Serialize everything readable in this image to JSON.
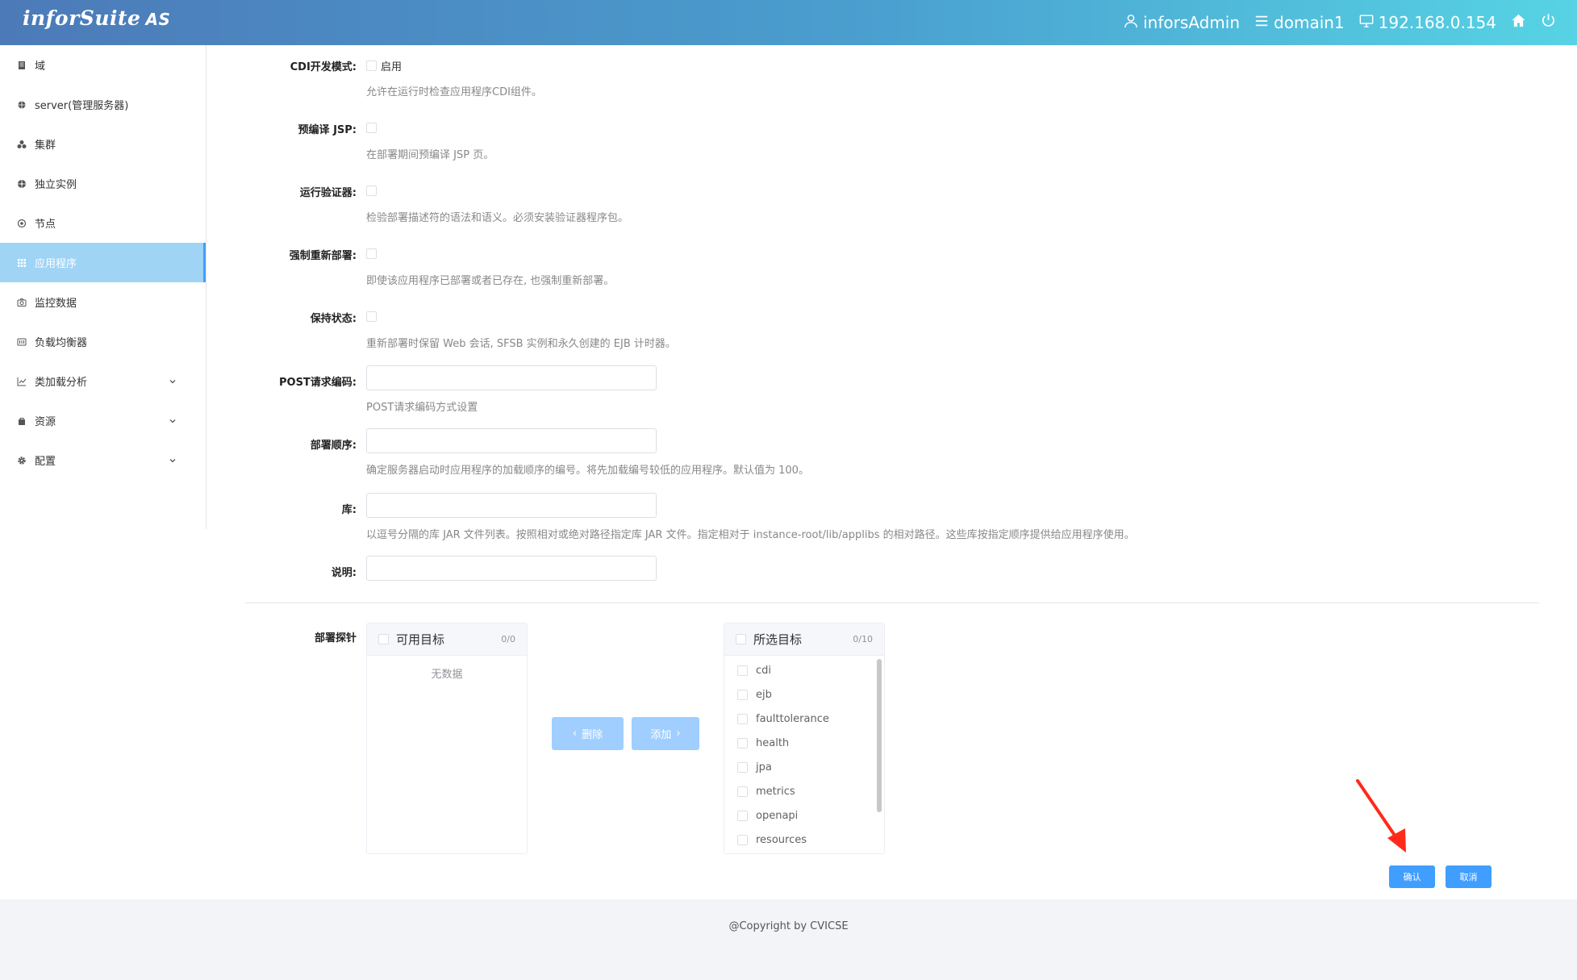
{
  "header": {
    "logo_main": "inforSuite",
    "logo_suffix": "AS",
    "user": "inforsAdmin",
    "domain": "domain1",
    "ip": "192.168.0.154",
    "icons": [
      "user-icon",
      "list-icon",
      "monitor-icon",
      "home-icon",
      "power-icon"
    ]
  },
  "sidebar": {
    "items": [
      {
        "label": "域",
        "icon": "domain-icon"
      },
      {
        "label": "server(管理服务器)",
        "icon": "server-icon"
      },
      {
        "label": "集群",
        "icon": "cluster-icon"
      },
      {
        "label": "独立实例",
        "icon": "instance-icon"
      },
      {
        "label": "节点",
        "icon": "node-icon"
      },
      {
        "label": "应用程序",
        "icon": "apps-icon",
        "active": true
      },
      {
        "label": "监控数据",
        "icon": "camera-icon"
      },
      {
        "label": "负载均衡器",
        "icon": "balancer-icon"
      },
      {
        "label": "类加载分析",
        "icon": "chart-icon",
        "expandable": true
      },
      {
        "label": "资源",
        "icon": "resource-icon",
        "expandable": true
      },
      {
        "label": "配置",
        "icon": "gear-icon",
        "expandable": true
      }
    ]
  },
  "form": {
    "cdi": {
      "label": "CDI开发模式:",
      "option": "启用",
      "help": "允许在运行时检查应用程序CDI组件。"
    },
    "precompile": {
      "label": "预编译 JSP:",
      "help": "在部署期间预编译 JSP 页。"
    },
    "verifier": {
      "label": "运行验证器:",
      "help": "检验部署描述符的语法和语义。必须安装验证器程序包。"
    },
    "force": {
      "label": "强制重新部署:",
      "help": "即使该应用程序已部署或者已存在, 也强制重新部署。"
    },
    "keep_state": {
      "label": "保持状态:",
      "help": "重新部署时保留 Web 会话, SFSB 实例和永久创建的 EJB 计时器。"
    },
    "post_encoding": {
      "label": "POST请求编码:",
      "value": "",
      "help": "POST请求编码方式设置"
    },
    "deploy_order": {
      "label": "部署顺序:",
      "value": "",
      "help": "确定服务器启动时应用程序的加载顺序的编号。将先加载编号较低的应用程序。默认值为 100。"
    },
    "libraries": {
      "label": "库:",
      "value": "",
      "help": "以逗号分隔的库 JAR 文件列表。按照相对或绝对路径指定库 JAR 文件。指定相对于 instance-root/lib/applibs 的相对路径。这些库按指定顺序提供给应用程序使用。"
    },
    "description": {
      "label": "说明:",
      "value": ""
    }
  },
  "probes": {
    "label": "部署探针",
    "available": {
      "title": "可用目标",
      "count": "0/0",
      "empty": "无数据"
    },
    "selected": {
      "title": "所选目标",
      "count": "0/10",
      "items": [
        "cdi",
        "ejb",
        "faulttolerance",
        "health",
        "jpa",
        "metrics",
        "openapi",
        "resources"
      ]
    },
    "remove_label": "删除",
    "add_label": "添加"
  },
  "actions": {
    "confirm": "确认",
    "cancel": "取消"
  },
  "footer": {
    "text": "@Copyright by CVICSE"
  },
  "colors": {
    "primary": "#409eff",
    "active_bg": "#9fd4f5",
    "annotation_arrow": "#ff2a1a"
  }
}
